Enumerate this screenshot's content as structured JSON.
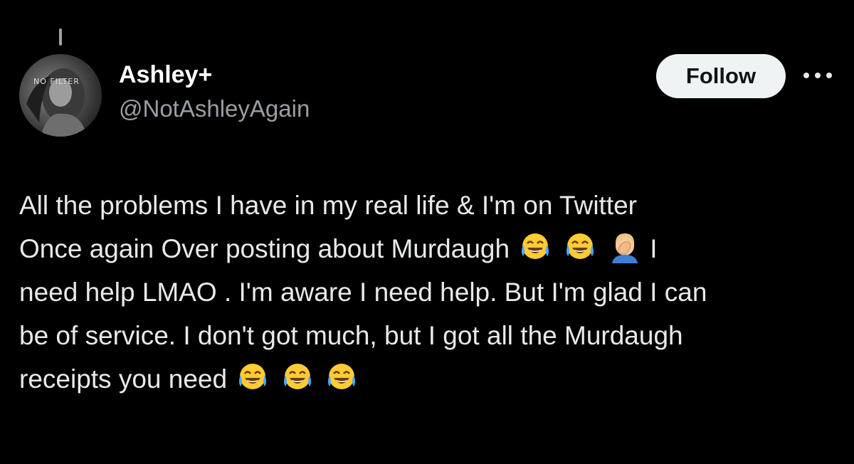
{
  "tweet": {
    "author": {
      "display_name": "Ashley+",
      "handle": "@NotAshleyAgain",
      "avatar_overlay_text": "NO FILTER"
    },
    "follow_label": "Follow",
    "text_lines": [
      {
        "text": "All the problems I have in my real life & I'm on Twitter"
      },
      {
        "text": "Once again Over posting about Murdaugh",
        "emojis_after": [
          "tears-of-joy-emoji",
          "tears-of-joy-emoji",
          "facepalm-emoji"
        ],
        "tail": "I"
      },
      {
        "text": "need help LMAO . I'm aware I need help. But I'm glad I can"
      },
      {
        "text": "be of service. I don't got much, but I got all the Murdaugh"
      },
      {
        "text": "receipts you need",
        "emojis_after": [
          "tears-of-joy-emoji",
          "tears-of-joy-emoji",
          "tears-of-joy-emoji"
        ]
      }
    ]
  },
  "colors": {
    "background": "#000000",
    "primary_text": "#e7e9ea",
    "secondary_text": "#9a9fa4",
    "follow_bg": "#eff3f4",
    "follow_text": "#0f1419"
  }
}
